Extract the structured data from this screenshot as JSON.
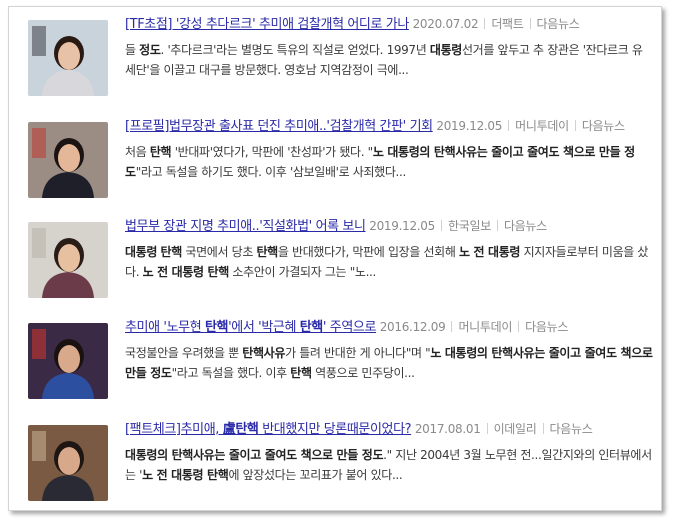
{
  "results": [
    {
      "title": "[TF초점] '강성 추다르크' 추미애 검찰개혁 어디로 가나",
      "date": "2020.07.02",
      "source": "더팩트",
      "more": "다음뉴스",
      "summary_parts": [
        {
          "t": "들 ",
          "b": false
        },
        {
          "t": "정도",
          "b": true
        },
        {
          "t": ". '추다르크'라는 별명도 특유의 직설로 얻었다. 1997년 ",
          "b": false
        },
        {
          "t": "대통령",
          "b": true
        },
        {
          "t": "선거를 앞두고 추 장관은 '잔다르크 유세단'을 이끌고 대구를 방문했다. 영호남 지역감정이 극에...",
          "b": false
        }
      ],
      "thumb": {
        "bg": "#c9d3dc",
        "skin": "#e8c2a6",
        "hair": "#2a1a14",
        "shirt": "#d8d8dc",
        "mark": "#404048"
      }
    },
    {
      "title": "[프로필]법무장관 출사표 던진 추미애..'검찰개혁 간판' 기회",
      "date": "2019.12.05",
      "source": "머니투데이",
      "more": "다음뉴스",
      "summary_parts": [
        {
          "t": "처음 ",
          "b": false
        },
        {
          "t": "탄핵",
          "b": true
        },
        {
          "t": " '반대파'였다가, 막판에 '찬성파'가 됐다. \"",
          "b": false
        },
        {
          "t": "노 대통령의 탄핵사유는 줄이고 줄여도 책으로 만들 정도",
          "b": true
        },
        {
          "t": "\"라고 독설을 하기도 했다. 이후 '삼보일배'로 사죄했다...",
          "b": false
        }
      ],
      "thumb": {
        "bg": "#9b8d84",
        "skin": "#e3b797",
        "hair": "#1c1412",
        "shirt": "#1f1f2a",
        "mark": "#c03a32"
      }
    },
    {
      "title": "법무부 장관 지명 추미애..'직설화법' 어록 보니",
      "date": "2019.12.05",
      "source": "한국일보",
      "more": "다음뉴스",
      "summary_parts": [
        {
          "t": "대통령",
          "b": true
        },
        {
          "t": " ",
          "b": false
        },
        {
          "t": "탄핵",
          "b": true
        },
        {
          "t": " 국면에서 당초 ",
          "b": false
        },
        {
          "t": "탄핵",
          "b": true
        },
        {
          "t": "을 반대했다가, 막판에 입장을 선회해 ",
          "b": false
        },
        {
          "t": "노 전 대통령",
          "b": true
        },
        {
          "t": " 지지자들로부터 미움을 샀다. ",
          "b": false
        },
        {
          "t": "노 전 대통령 탄핵",
          "b": true
        },
        {
          "t": " 소추안이 가결되자 그는 \"노...",
          "b": false
        }
      ],
      "thumb": {
        "bg": "#d6d2cc",
        "skin": "#e7c0a0",
        "hair": "#2a1c16",
        "shirt": "#6b3b4a",
        "mark": "#b8b2aa"
      }
    },
    {
      "title_parts": [
        {
          "t": "추미애 '노무현 ",
          "b": false
        },
        {
          "t": "탄핵",
          "b": true
        },
        {
          "t": "'에서 '박근혜 ",
          "b": false
        },
        {
          "t": "탄핵",
          "b": true
        },
        {
          "t": "' 주역으로",
          "b": false
        }
      ],
      "date": "2016.12.09",
      "source": "머니투데이",
      "more": "다음뉴스",
      "summary_parts": [
        {
          "t": "국정불안을 우려했을 뿐 ",
          "b": false
        },
        {
          "t": "탄핵사유",
          "b": true
        },
        {
          "t": "가 틀려 반대한 게 아니다\"며 \"",
          "b": false
        },
        {
          "t": "노 대통령의 탄핵사유는 줄이고 줄여도 책으로 만들 정도",
          "b": true
        },
        {
          "t": "\"라고 독설을 했다. 이후 ",
          "b": false
        },
        {
          "t": "탄핵",
          "b": true
        },
        {
          "t": " 역풍으로 민주당이...",
          "b": false
        }
      ],
      "thumb": {
        "bg": "#3a2a46",
        "skin": "#d9a98c",
        "hair": "#1a1210",
        "shirt": "#2c4fa0",
        "mark": "#d2342c"
      }
    },
    {
      "title_parts": [
        {
          "t": "[팩트체크]추미애, ",
          "b": false
        },
        {
          "t": "盧탄핵",
          "b": true
        },
        {
          "t": " 반대했지만 당론때문이었다?",
          "b": false
        }
      ],
      "date": "2017.08.01",
      "source": "이데일리",
      "more": "다음뉴스",
      "summary_parts": [
        {
          "t": "대통령의 탄핵사유는 줄이고 줄여도 책으로 만들 정도",
          "b": true
        },
        {
          "t": ".\" 지난 2004년 3월 노무현 전...일간지와의 인터뷰에서는 '",
          "b": false
        },
        {
          "t": "노 전 대통령 탄핵",
          "b": true
        },
        {
          "t": "에 앞장섰다는 꼬리표가 붙어 있다...",
          "b": false
        }
      ],
      "thumb": {
        "bg": "#7a5a42",
        "skin": "#d8a88a",
        "hair": "#1e1612",
        "shirt": "#2a2a34",
        "mark": "#c9b496"
      }
    }
  ]
}
